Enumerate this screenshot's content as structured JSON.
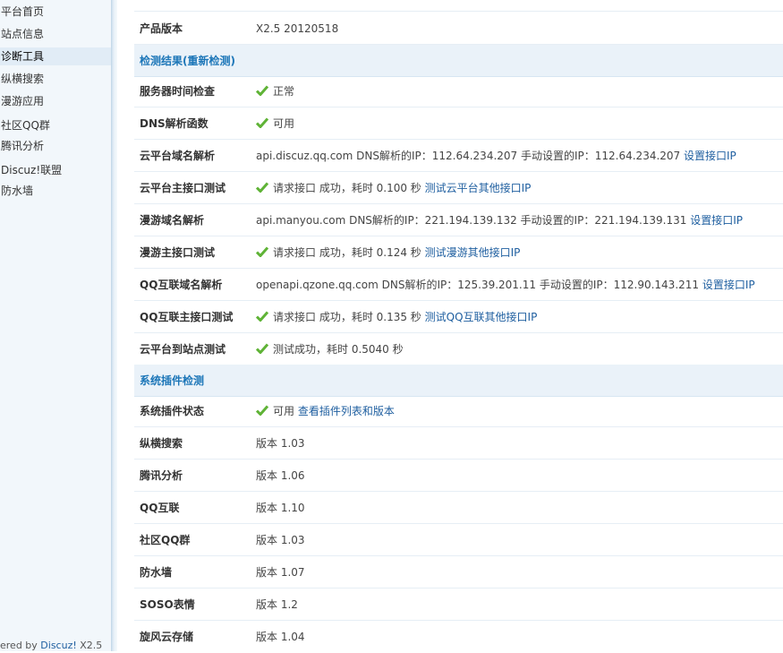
{
  "sidebar": {
    "items": [
      {
        "label": "平台首页"
      },
      {
        "label": "站点信息"
      },
      {
        "label": "诊断工具",
        "active": true
      },
      {
        "label": "纵横搜索"
      },
      {
        "label": "漫游应用"
      },
      {
        "label": "社区QQ群"
      },
      {
        "label": "腾讯分析"
      },
      {
        "label": "Discuz!联盟"
      },
      {
        "label": "防水墙"
      }
    ],
    "powered_prefix": "ered by ",
    "powered_link": "Discuz!",
    "powered_version": " X2.5"
  },
  "product": {
    "label": "产品版本",
    "value": "X2.5 20120518"
  },
  "section_detect": {
    "title": "检测结果(重新检测)"
  },
  "rows": {
    "server_time": {
      "label": "服务器时间检查",
      "value": "正常"
    },
    "dns_func": {
      "label": "DNS解析函数",
      "value": "可用"
    },
    "cloud_domain": {
      "label": "云平台域名解析",
      "value": "api.discuz.qq.com DNS解析的IP：112.64.234.207 手动设置的IP：112.64.234.207",
      "link": "设置接口IP"
    },
    "cloud_api": {
      "label": "云平台主接口测试",
      "value": "请求接口 成功，耗时 0.100 秒",
      "link": "测试云平台其他接口IP"
    },
    "manyou_domain": {
      "label": "漫游域名解析",
      "value": "api.manyou.com DNS解析的IP：221.194.139.132 手动设置的IP：221.194.139.131",
      "link": "设置接口IP"
    },
    "manyou_api": {
      "label": "漫游主接口测试",
      "value": "请求接口 成功，耗时 0.124 秒",
      "link": "测试漫游其他接口IP"
    },
    "qq_domain": {
      "label": "QQ互联域名解析",
      "value": "openapi.qzone.qq.com DNS解析的IP：125.39.201.11 手动设置的IP：112.90.143.211",
      "link": "设置接口IP"
    },
    "qq_api": {
      "label": "QQ互联主接口测试",
      "value": "请求接口 成功，耗时 0.135 秒",
      "link": "测试QQ互联其他接口IP"
    },
    "cloud_site": {
      "label": "云平台到站点测试",
      "value": "测试成功，耗时 0.5040 秒"
    }
  },
  "section_plugin": {
    "title": "系统插件检测"
  },
  "plugin_status": {
    "label": "系统插件状态",
    "value": "可用",
    "link": "查看插件列表和版本"
  },
  "plugins": [
    {
      "label": "纵横搜索",
      "value": "版本 1.03"
    },
    {
      "label": "腾讯分析",
      "value": "版本 1.06"
    },
    {
      "label": "QQ互联",
      "value": "版本 1.10"
    },
    {
      "label": "社区QQ群",
      "value": "版本 1.03"
    },
    {
      "label": "防水墙",
      "value": "版本 1.07"
    },
    {
      "label": "SOSO表情",
      "value": "版本 1.2"
    },
    {
      "label": "旋风云存储",
      "value": "版本 1.04"
    }
  ],
  "colors": {
    "check": "#5fb336",
    "link": "#1f5fa0",
    "section_title": "#1c76b8"
  }
}
